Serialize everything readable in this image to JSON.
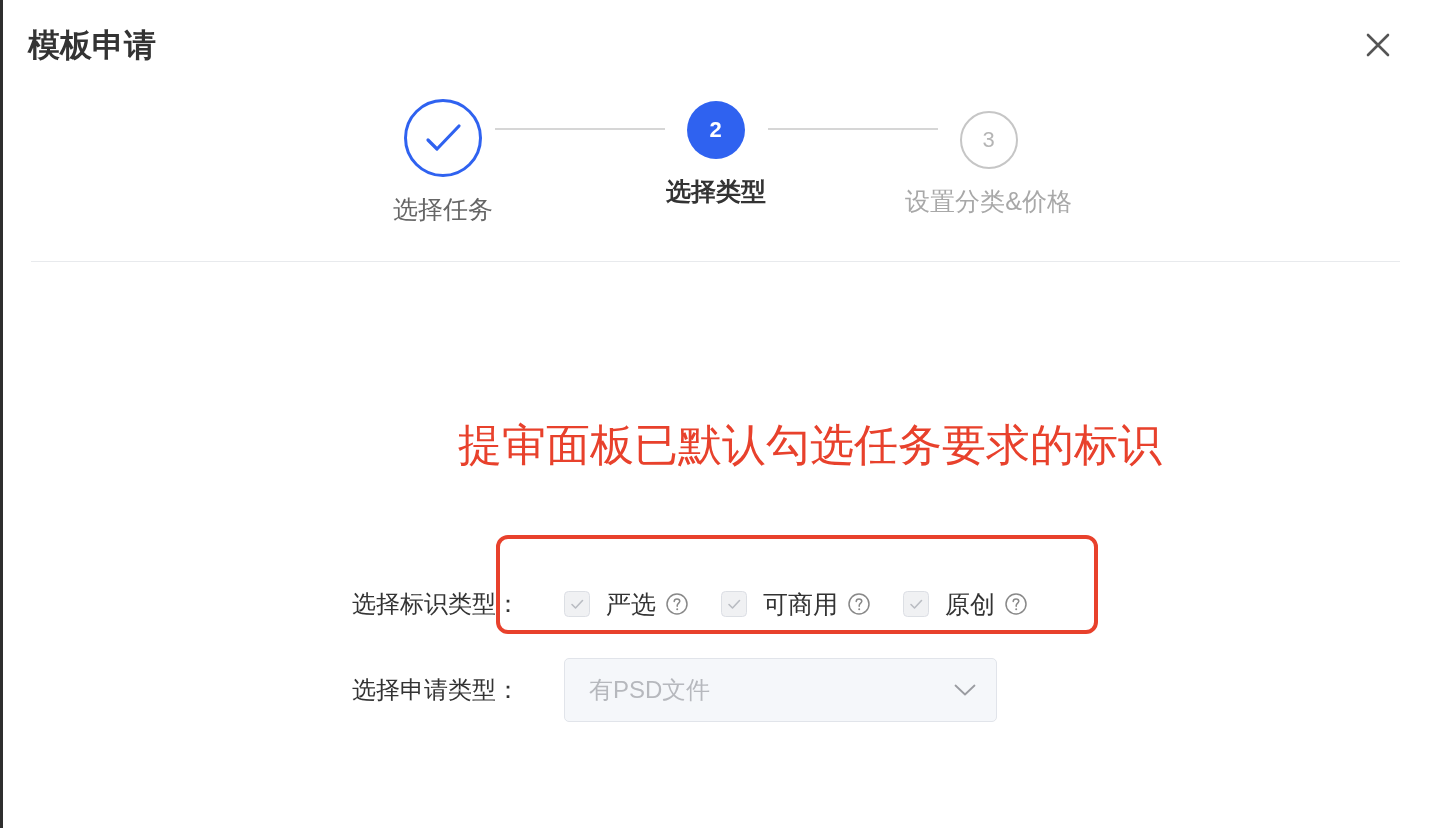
{
  "dialog": {
    "title": "模板申请"
  },
  "steps": [
    {
      "label": "选择任务",
      "completed": true,
      "selected": false
    },
    {
      "number": "2",
      "label": "选择类型",
      "completed": false,
      "selected": true
    },
    {
      "number": "3",
      "label": "设置分类&价格",
      "completed": false,
      "selected": false
    }
  ],
  "annotation": {
    "text": "提审面板已默认勾选任务要求的标识"
  },
  "form": {
    "tag_row": {
      "label": "选择标识类型：",
      "options": [
        {
          "label": "严选",
          "checked": true,
          "disabled": true
        },
        {
          "label": "可商用",
          "checked": true,
          "disabled": true
        },
        {
          "label": "原创",
          "checked": true,
          "disabled": true
        }
      ]
    },
    "type_row": {
      "label": "选择申请类型：",
      "select": {
        "value": "有PSD文件",
        "disabled": true
      }
    }
  }
}
